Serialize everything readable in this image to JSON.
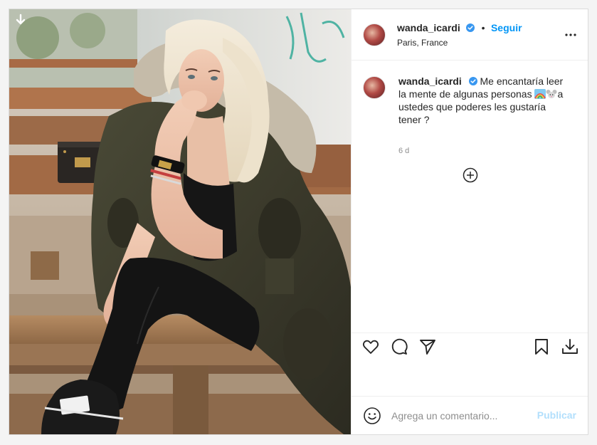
{
  "post": {
    "photo": {
      "alt_subject": "woman in olive parka seated on wooden bench",
      "download_icon": "arrow-down-icon"
    },
    "header": {
      "username": "wanda_icardi",
      "verified": true,
      "separator": "•",
      "follow_label": "Seguir",
      "location": "Paris, France",
      "more_icon": "more-horizontal-icon"
    },
    "caption": {
      "username": "wanda_icardi",
      "text_before": "Me encantaría leer la mente de algunas personas",
      "emojis": [
        "rainbow-emoji",
        "mouse-face-emoji"
      ],
      "text_after": "a ustedes que poderes les gustaría tener ?",
      "time": "6 d"
    },
    "load_more_icon": "plus-circle-icon",
    "actions": {
      "like_icon": "heart-icon",
      "comment_icon": "comment-icon",
      "share_icon": "send-icon",
      "save_icon": "bookmark-icon",
      "download_icon": "download-icon"
    },
    "comment_bar": {
      "emoji_icon": "smiley-icon",
      "placeholder": "Agrega un comentario...",
      "publish_label": "Publicar"
    }
  },
  "colors": {
    "link_blue": "#0095f6",
    "publish_disabled": "#b2dffc",
    "text": "#262626",
    "muted": "#8e8e8e",
    "border": "#dbdbdb"
  }
}
